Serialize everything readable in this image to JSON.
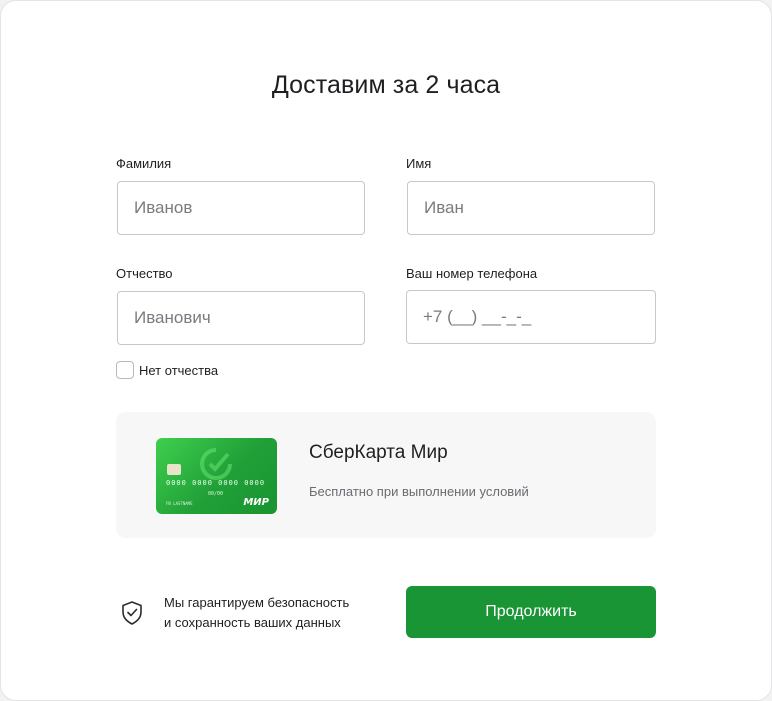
{
  "form": {
    "title": "Доставим за 2 часа",
    "surname": {
      "label": "Фамилия",
      "placeholder": "Иванов"
    },
    "name": {
      "label": "Имя",
      "placeholder": "Иван"
    },
    "patronymic": {
      "label": "Отчество",
      "placeholder": "Иванович"
    },
    "phone": {
      "label": "Ваш номер телефона",
      "placeholder": "+7 (__) __-_-_"
    },
    "no_patronymic_label": "Нет отчества"
  },
  "card_promo": {
    "title": "СберКарта Мир",
    "subtitle": "Бесплатно при выполнении условий",
    "card_number": "0000 0000 0000 0000",
    "card_expiry": "00/00",
    "card_holder": "FN LASTNAME",
    "card_brand": "МИР",
    "card_color": "#21a038"
  },
  "security": {
    "icon": "shield-check-icon",
    "text_line1": "Мы гарантируем безопасность",
    "text_line2": "и сохранность ваших данных"
  },
  "actions": {
    "continue_label": "Продолжить",
    "button_color": "#1a9535"
  }
}
